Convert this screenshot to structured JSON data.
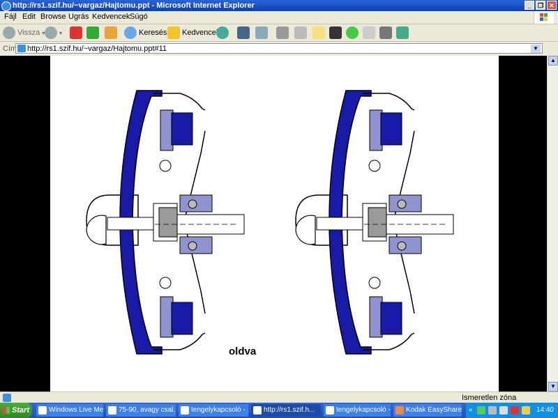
{
  "window": {
    "title": "http://rs1.szif.hu/~vargaz/Hajtomu.ppt - Microsoft Internet Explorer"
  },
  "menu": [
    "Fájl",
    "Edit",
    "Browse",
    "Ugrás",
    "Kedvencek",
    "Súgó"
  ],
  "toolbar": {
    "back_label": "Vissza",
    "search_label": "Keresés",
    "favorites_label": "Kedvencek"
  },
  "address": {
    "label": "Cím",
    "url": "http://rs1.szif.hu/~vargaz/Hajtomu.ppt#11"
  },
  "slide": {
    "caption": "oldva"
  },
  "status": {
    "zone": "Ismeretlen zóna"
  },
  "taskbar": {
    "start_label": "Start",
    "tasks": [
      "Windows Live Mes...",
      "75-90, avagy csal...",
      "tengelykapcsoló - ...",
      "http://rs1.szif.h...",
      "tengelykapcsoló - ...",
      "Kodak EasyShare ..."
    ],
    "clock": "14:40"
  },
  "colors": {
    "clutch_blue": "#1a1aa8",
    "clutch_light": "#8f93d0",
    "xp_blue": "#0a3fb8"
  }
}
